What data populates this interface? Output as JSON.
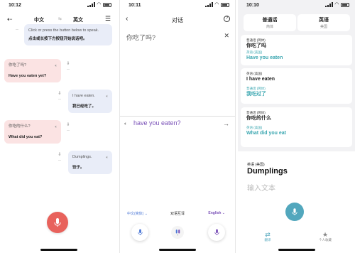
{
  "panel1": {
    "time": "10:12",
    "lang_left": "中文",
    "lang_swap": "⇆",
    "lang_right": "英文",
    "bubbles": [
      {
        "line1": "Click or press the button below to speak.",
        "line2": "点击或长按下方按钮开始说话吧。"
      },
      {
        "line1": "你吃了吗?",
        "line2": "Have you eaten yet?"
      },
      {
        "line1": "I have eaten.",
        "line2": "我已经吃了。"
      },
      {
        "line1": "你吃的什么?",
        "line2": "What did you eat?"
      },
      {
        "line1": "Dumplings.",
        "line2": "饺子。"
      }
    ]
  },
  "panel2": {
    "time": "10:11",
    "title": "对话",
    "help": "?",
    "source_text": "你吃了吗?",
    "output_text": "have you eaten?",
    "lang_left": "中文(简体) ⌄",
    "mode_label": "双语互译",
    "lang_right": "English ⌄"
  },
  "panel3": {
    "time": "10:10",
    "lang_a_name": "普通话",
    "lang_a_sub": "简体",
    "lang_b_name": "英语",
    "lang_b_sub": "美国",
    "card1": {
      "label": "普通话 (简体)",
      "text": "你吃了吗",
      "label2": "英语 (美国)",
      "text2": "Have you eaten"
    },
    "card2": {
      "label": "英语 (美国)",
      "text": "I have eaten",
      "label2": "普通话 (简体)",
      "text2": "我吃过了"
    },
    "card3": {
      "label": "普通话 (简体)",
      "text": "你吃的什么",
      "label2": "英语 (美国)",
      "text2": "What did you eat"
    },
    "bottom_label": "英语 (美国)",
    "bottom_text": "Dumplings",
    "input_placeholder": "输入文本",
    "tab_translate": "翻译",
    "tab_favorites": "个人收藏"
  },
  "colors": {
    "accent_red": "#e8625c",
    "accent_purple": "#7b52b8",
    "accent_blue": "#4d78d6",
    "accent_teal": "#3aa6b0"
  }
}
